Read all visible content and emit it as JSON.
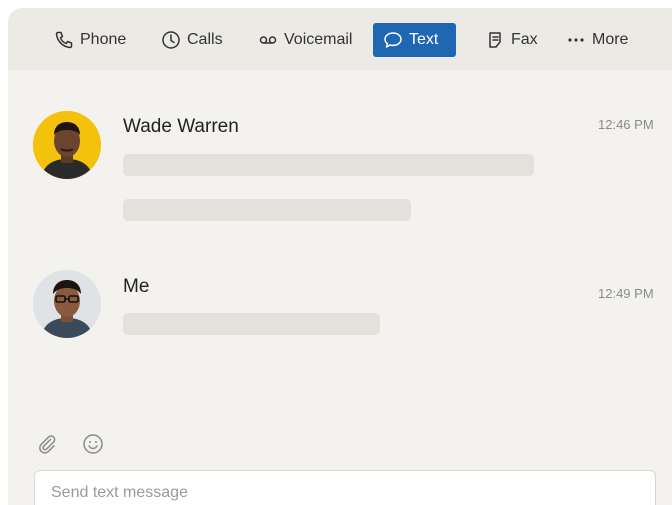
{
  "toolbar": {
    "tabs": [
      {
        "label": "Phone",
        "icon": "phone-icon"
      },
      {
        "label": "Calls",
        "icon": "clock-icon"
      },
      {
        "label": "Voicemail",
        "icon": "voicemail-icon"
      },
      {
        "label": "Text",
        "icon": "chat-bubble-icon",
        "active": true
      },
      {
        "label": "Fax",
        "icon": "fax-icon"
      },
      {
        "label": "More",
        "icon": "more-dots-icon"
      }
    ]
  },
  "messages": [
    {
      "sender": "Wade Warren",
      "time": "12:46 PM"
    },
    {
      "sender": "Me",
      "time": "12:49 PM"
    }
  ],
  "composer": {
    "placeholder": "Send text message",
    "tools": [
      "paperclip-icon",
      "emoji-icon"
    ]
  },
  "colors": {
    "accent": "#1f66b3",
    "panel": "#f3f2ef",
    "toolbar": "#eceae5",
    "skeleton": "#e3e1dc",
    "avatar_bg_1": "#f4c20d"
  }
}
